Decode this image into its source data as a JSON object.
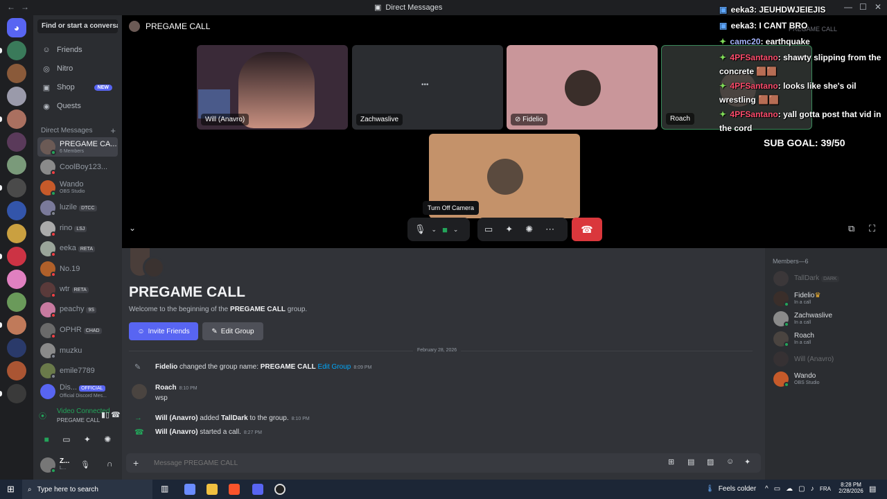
{
  "window": {
    "title": "Direct Messages",
    "nav_back": "←",
    "nav_fwd": "→",
    "minimize": "—",
    "maximize": "☐",
    "close": "✕"
  },
  "sidebar": {
    "search_button": "Find or start a conversation",
    "nav": [
      {
        "label": "Friends",
        "icon": "friends-icon",
        "glyph": "☺"
      },
      {
        "label": "Nitro",
        "icon": "nitro-icon",
        "glyph": "◎"
      },
      {
        "label": "Shop",
        "icon": "shop-icon",
        "glyph": "▣",
        "badge": "NEW"
      },
      {
        "label": "Quests",
        "icon": "quests-icon",
        "glyph": "◉"
      }
    ],
    "dm_header": "Direct Messages",
    "dm_add": "+",
    "dms": [
      {
        "name": "PREGAME CA...",
        "sub": "6 Members",
        "status": "#23a55a",
        "color": "#6b5a55",
        "active": true
      },
      {
        "name": "CoolBoy123...",
        "sub": "",
        "status": "#f23f43",
        "color": "#8a8a8a"
      },
      {
        "name": "Wando",
        "sub": "OBS Studio",
        "status": "#23a55a",
        "color": "#c65a2a"
      },
      {
        "name": "luzile",
        "tag": "DTCC",
        "status": "#80848e",
        "color": "#7a7a9a"
      },
      {
        "name": "rino",
        "tag": "LSJ",
        "status": "#f23f43",
        "color": "#aaaaaa"
      },
      {
        "name": "eeka",
        "tag": "RETA",
        "status": "#f23f43",
        "color": "#9aa59a"
      },
      {
        "name": "No.19",
        "sub": "",
        "status": "#f23f43",
        "color": "#b0602a"
      },
      {
        "name": "wtr",
        "tag": "RETA",
        "status": "#f23f43",
        "color": "#5a3a3a"
      },
      {
        "name": "peachy",
        "tag": "9S",
        "status": "#f23f43",
        "color": "#c87aa0"
      },
      {
        "name": "OPHR",
        "tag": "CHAD",
        "status": "#f23f43",
        "color": "#6a6a6a"
      },
      {
        "name": "muzku",
        "sub": "",
        "status": "#80848e",
        "color": "#8a8a8a"
      },
      {
        "name": "emile7789",
        "sub": "",
        "status": "#80848e",
        "color": "#6a7a4a"
      },
      {
        "name": "Dis...",
        "tag": "OFFICIAL",
        "sub": "Official Discord Mes...",
        "status": "",
        "color": "#5865f2"
      }
    ],
    "voice": {
      "status": "Video Connected",
      "channel": "PREGAME CALL"
    },
    "user": {
      "name": "Z...",
      "sub": "L..."
    }
  },
  "call": {
    "title": "PREGAME CALL",
    "tiles": [
      {
        "label": "Will (Anavro)",
        "bg": "#3a2a38",
        "video": true
      },
      {
        "label": "Zachwaslive",
        "bg": "#2b2d31",
        "dots": "•••"
      },
      {
        "label": "Fidelio",
        "bg": "#c9969a",
        "avatar": "#3a2e2a",
        "muted": true
      },
      {
        "label": "Roach",
        "bg": "#2a2e2c",
        "avatar": "#4a4440"
      },
      {
        "label": "",
        "bg": "#c4926a",
        "avatar": "#5a4a3e"
      }
    ],
    "tooltip": "Turn Off Camera",
    "end_call": "end-call-icon"
  },
  "chat": {
    "group_title": "PREGAME CALL",
    "welcome_pre": "Welcome to the beginning of the ",
    "welcome_name": "PREGAME CALL",
    "welcome_post": " group.",
    "invite_button": "Invite Friends",
    "edit_button": "Edit Group",
    "date_divider": "February 28, 2026",
    "messages": [
      {
        "author": "Fidelio",
        "text": " changed the group name: ",
        "strong": "PREGAME CALL",
        "link": " Edit Group",
        "time": "8:09 PM"
      },
      {
        "author": "Roach",
        "time": "8:10 PM",
        "body": "wsp"
      },
      {
        "author": "Will (Anavro)",
        "text": " added ",
        "strong": "TallDark",
        "text2": " to the group.",
        "time": "8:10 PM"
      },
      {
        "author": "Will (Anavro)",
        "text": " started a call.",
        "time": "8:27 PM"
      }
    ],
    "input_placeholder": "Message PREGAME CALL"
  },
  "members": {
    "header": "Members—6",
    "list": [
      {
        "name": "TallDark",
        "tag": "DARK",
        "sub": "",
        "color": "#5a4a4a",
        "dim": true
      },
      {
        "name": "Fidelio",
        "crown": "♛",
        "sub": "In a call",
        "color": "#3a2e2a"
      },
      {
        "name": "Zachwaslive",
        "sub": "In a call",
        "color": "#8a8a8a"
      },
      {
        "name": "Roach",
        "sub": "In a call",
        "color": "#4a4440"
      },
      {
        "name": "Will (Anavro)",
        "sub": "",
        "color": "#4a3a3a",
        "dim": true
      },
      {
        "name": "Wando",
        "sub": "OBS Studio",
        "color": "#c65a2a"
      }
    ]
  },
  "overlay": {
    "lines": [
      {
        "user": "eeka3",
        "text": ": JEUHDWJEIEJIS",
        "ucolor": "#ffffff"
      },
      {
        "user": "eeka3",
        "text": ": I CANT BRO",
        "ucolor": "#ffffff"
      },
      {
        "user": "camc20",
        "text": ": earthquake",
        "ucolor": "#a5b4fc"
      },
      {
        "user": "4PFSantano",
        "text": ": shawty slipping from the concrete 🟫🟫",
        "ucolor": "#ff4d6d"
      },
      {
        "user": "4PFSantano",
        "text": ": looks like she's oil wrestling 🟫🟫",
        "ucolor": "#ff4d6d"
      },
      {
        "user": "4PFSantano",
        "text": ": yall gotta post that vid in the cord",
        "ucolor": "#ff4d6d"
      }
    ],
    "sub_goal": "SUB GOAL: 39/50",
    "search_ghost": "PREGAME CALL"
  },
  "taskbar": {
    "search": "Type here to search",
    "weather": "Feels colder",
    "lang": "FRA",
    "time": "8:28 PM",
    "date": "2/28/2026"
  }
}
